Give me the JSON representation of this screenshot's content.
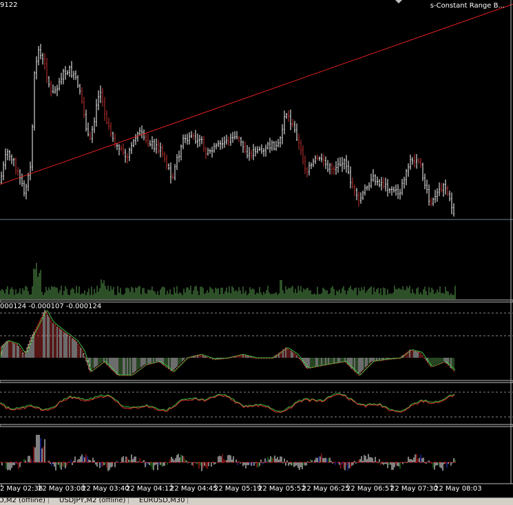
{
  "header": {
    "price_label_partial": "9122",
    "indicator_title": "s-Constant Range B..."
  },
  "macd_label": "000124 -0.000107 -0.000124",
  "time_axis": [
    "2 May 02:36",
    "22 May 03:08",
    "22 May 03:40",
    "22 May 04:12",
    "22 May 04:45",
    "22 May 05:19",
    "22 May 05:52",
    "22 May 06:25",
    "22 May 06:57",
    "22 May 07:30",
    "22 May 08:03"
  ],
  "tabs": [
    "D,M2 (offline)",
    "USDJPY,M2 (offline)",
    "EURUSD,M30"
  ],
  "colors": {
    "background": "#000000",
    "bar": "#ffffff",
    "bear_bar": "#c83232",
    "trendline": "#e02020",
    "volume": "#5aa050",
    "macd_pos": "#c83232",
    "macd_neg": "#5aa050",
    "signal_green": "#40c040",
    "signal_red": "#e03030",
    "separator": "#c0c0c0"
  }
}
